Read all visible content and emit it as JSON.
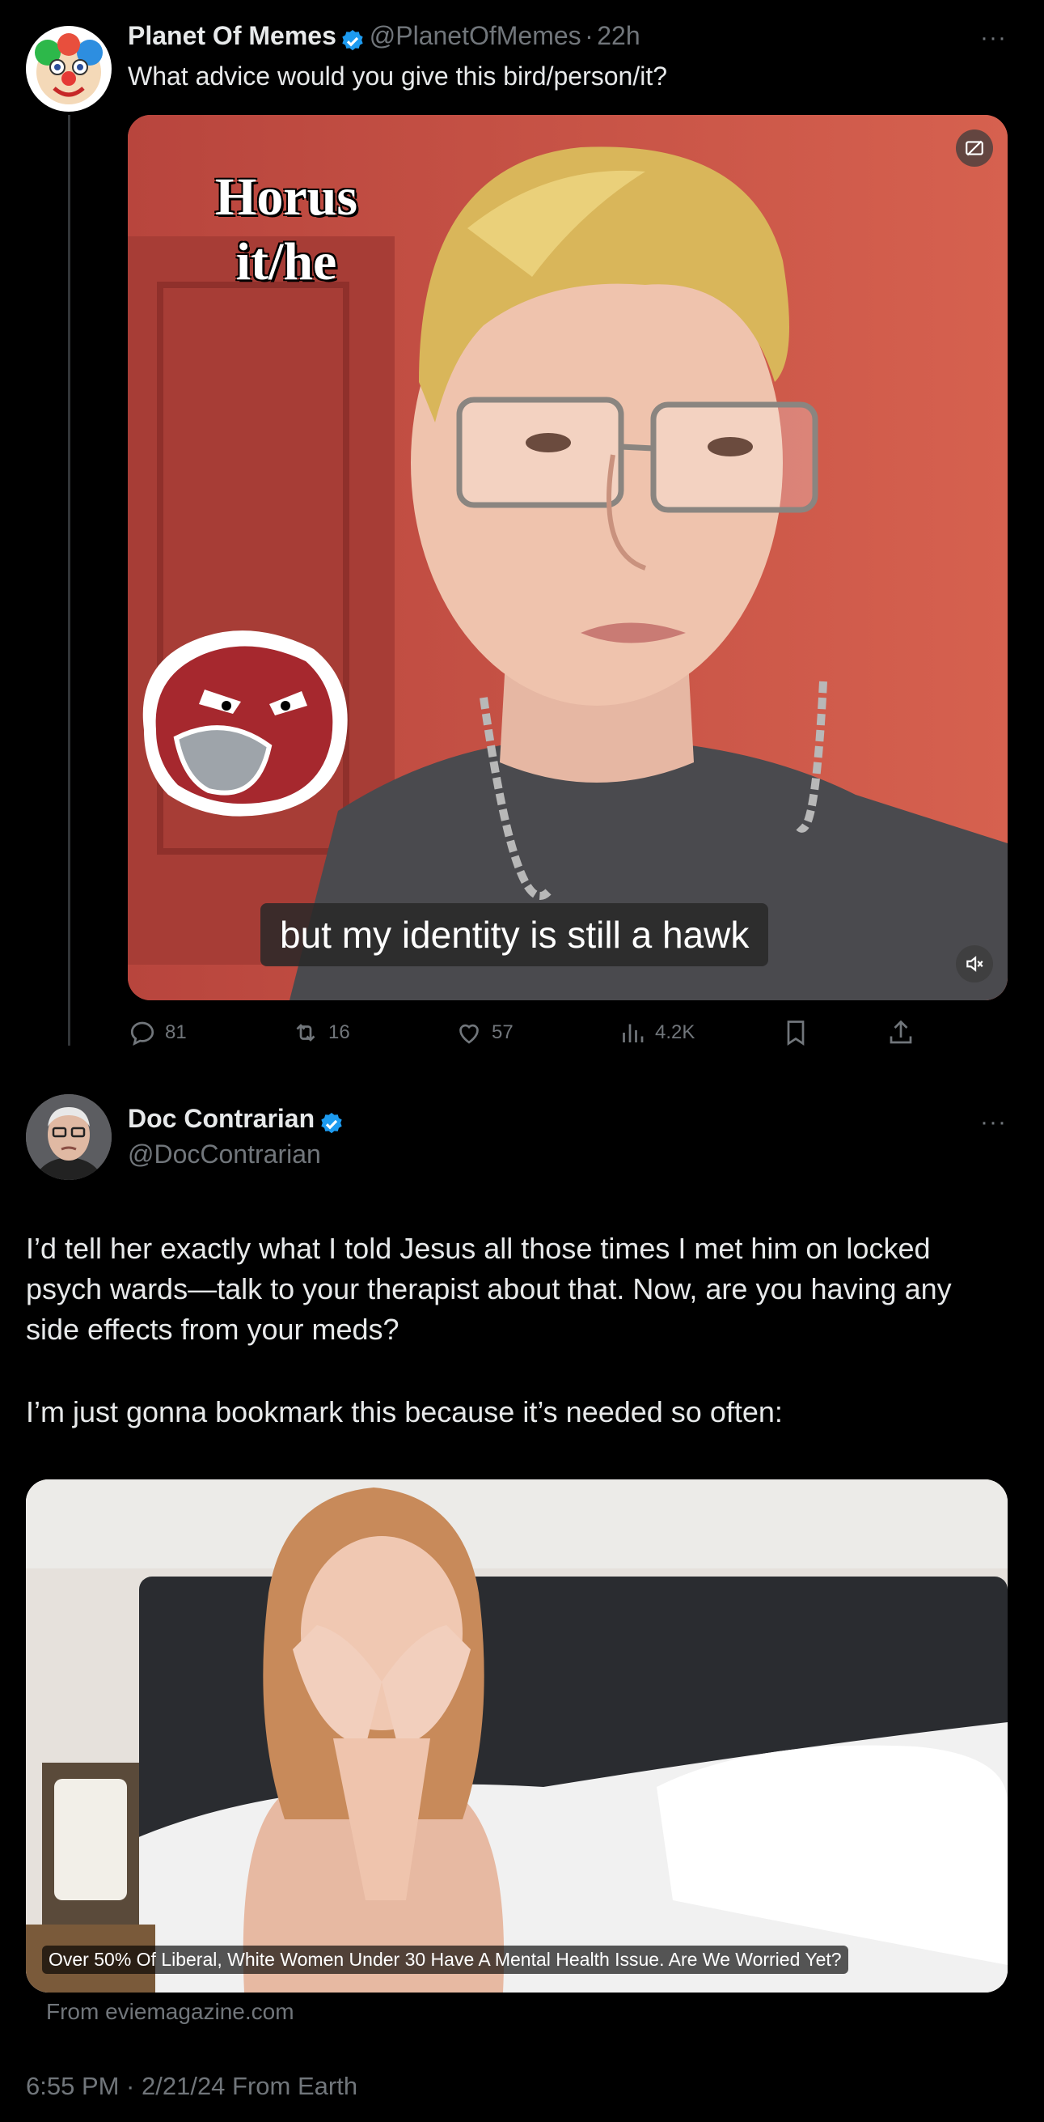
{
  "post": {
    "display_name": "Planet Of Memes",
    "handle": "@PlanetOfMemes",
    "separator": "·",
    "time": "22h",
    "text": "What advice would you give this bird/person/it?",
    "media": {
      "overlay_title_line1": "Horus",
      "overlay_title_line2": "it/he",
      "subtitle": "but my identity is still a hawk"
    },
    "actions": {
      "replies": "81",
      "reposts": "16",
      "likes": "57",
      "views": "4.2K"
    }
  },
  "reply": {
    "display_name": "Doc Contrarian",
    "handle": "@DocContrarian",
    "paragraph1": "I’d tell her exactly what I told Jesus all those times I met him on locked psych wards—talk to your therapist about that. Now, are you having any side effects from your meds?",
    "paragraph2": "I’m just gonna bookmark this because it’s needed so often:",
    "card": {
      "caption": "Over 50% Of Liberal, White Women Under 30 Have A Mental Health Issue. Are We Worried Yet?",
      "source": "From eviemagazine.com"
    },
    "timestamp": "6:55 PM · 2/21/24 From Earth"
  },
  "colors": {
    "background": "#000000",
    "text_primary": "#e7e9ea",
    "text_secondary": "#71767b",
    "verified": "#1d9bf0",
    "thread_line": "#333639"
  }
}
